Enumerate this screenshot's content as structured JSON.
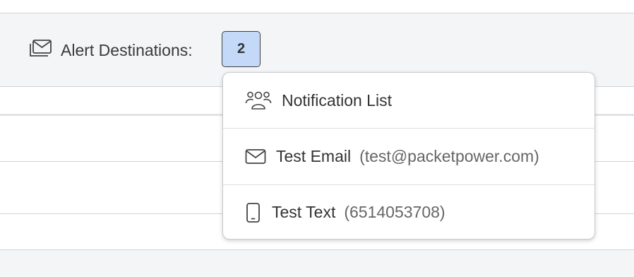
{
  "alert": {
    "label": "Alert Destinations:",
    "count": "2",
    "icon": "envelopes-icon"
  },
  "dropdown": {
    "items": [
      {
        "label": "Notification List",
        "detail": "",
        "icon": "people-group-icon"
      },
      {
        "label": "Test Email",
        "detail": "(test@packetpower.com)",
        "icon": "envelope-icon"
      },
      {
        "label": "Test Text",
        "detail": "(6514053708)",
        "icon": "mobile-phone-icon"
      }
    ]
  },
  "colors": {
    "badge_background": "#c3d9f7",
    "header_background": "#f4f5f7"
  }
}
